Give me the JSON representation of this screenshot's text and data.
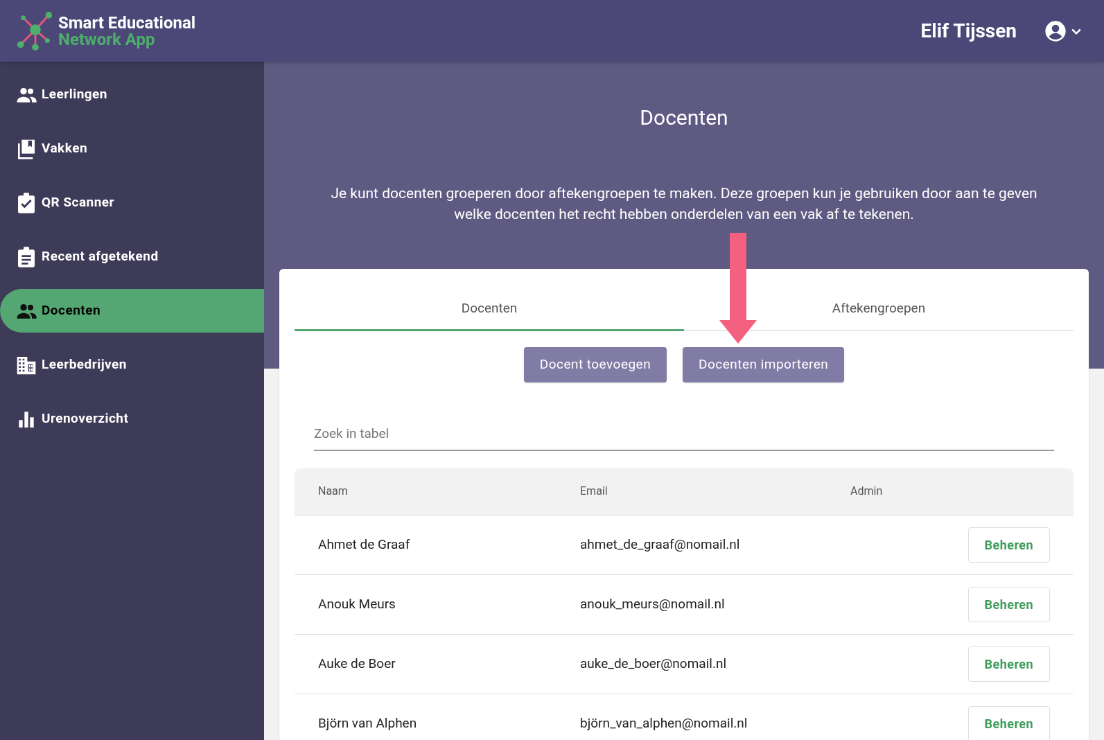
{
  "header": {
    "logo_line1": "Smart Educational",
    "logo_line2": "Network App",
    "user_name": "Elif Tijssen"
  },
  "sidebar": {
    "items": [
      {
        "label": "Leerlingen",
        "selected": false
      },
      {
        "label": "Vakken",
        "selected": false
      },
      {
        "label": "QR Scanner",
        "selected": false
      },
      {
        "label": "Recent afgetekend",
        "selected": false
      },
      {
        "label": "Docenten",
        "selected": true
      },
      {
        "label": "Leerbedrijven",
        "selected": false
      },
      {
        "label": "Urenoverzicht",
        "selected": false
      }
    ]
  },
  "page": {
    "title": "Docenten",
    "description": "Je kunt docenten groeperen door aftekengroepen te maken. Deze groepen kun je gebruiken door aan te geven welke docenten het recht hebben onderdelen van een vak af te tekenen."
  },
  "tabs": [
    {
      "label": "Docenten",
      "selected": true
    },
    {
      "label": "Aftekengroepen",
      "selected": false
    }
  ],
  "buttons": [
    "Docent toevoegen",
    "Docenten importeren"
  ],
  "search": {
    "placeholder": "Zoek in tabel"
  },
  "table": {
    "columns": [
      "Naam",
      "Email",
      "Admin"
    ],
    "rows": [
      {
        "name": "Ahmet de Graaf",
        "email": "ahmet_de_graaf@nomail.nl",
        "action": "Beheren"
      },
      {
        "name": "Anouk Meurs",
        "email": "anouk_meurs@nomail.nl",
        "action": "Beheren"
      },
      {
        "name": "Auke de Boer",
        "email": "auke_de_boer@nomail.nl",
        "action": "Beheren"
      },
      {
        "name": "Björn van Alphen",
        "email": "björn_van_alphen@nomail.nl",
        "action": "Beheren"
      }
    ]
  }
}
